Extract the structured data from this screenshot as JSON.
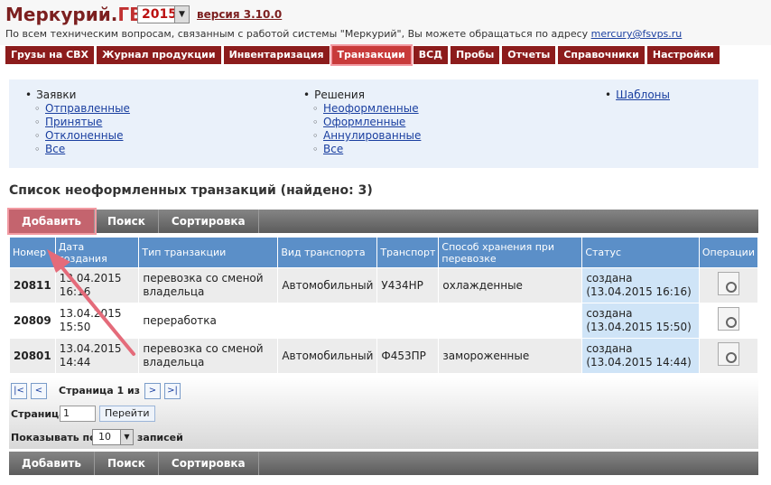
{
  "header": {
    "logo_main": "Меркурий.",
    "logo_accent": "ГВЭ",
    "year": "2015",
    "version": "версия 3.10.0",
    "support_text": "По всем техническим вопросам, связанным с работой системы \"Меркурий\", Вы можете обращаться по адресу ",
    "support_email": "mercury@fsvps.ru"
  },
  "nav": [
    "Грузы на СВХ",
    "Журнал продукции",
    "Инвентаризация",
    "Транзакции",
    "ВСД",
    "Пробы",
    "Отчеты",
    "Справочники",
    "Настройки"
  ],
  "nav_active": "Транзакции",
  "submenu": {
    "requests": {
      "title": "Заявки",
      "items": [
        "Отправленные",
        "Принятые",
        "Отклоненные",
        "Все"
      ]
    },
    "decisions": {
      "title": "Решения",
      "items": [
        "Неоформленные",
        "Оформленные",
        "Аннулированные",
        "Все"
      ]
    },
    "templates": "Шаблоны"
  },
  "list_title": "Список неоформленных транзакций (найдено: 3)",
  "toolbar": {
    "add": "Добавить",
    "search": "Поиск",
    "sort": "Сортировка"
  },
  "table": {
    "columns": [
      "Номер",
      "Дата создания",
      "Тип транзакции",
      "Вид транспорта",
      "Транспорт",
      "Способ хранения при перевозке",
      "Статус",
      "Операции"
    ],
    "rows": [
      {
        "num": "20811",
        "date": "13.04.2015 16:16",
        "type": "перевозка со сменой владельца",
        "transport_kind": "Автомобильный",
        "transport": "У434НР",
        "storage": "охлажденные",
        "status": "создана (13.04.2015 16:16)"
      },
      {
        "num": "20809",
        "date": "13.04.2015 15:50",
        "type": "переработка",
        "transport_kind": "",
        "transport": "",
        "storage": "",
        "status": "создана (13.04.2015 15:50)"
      },
      {
        "num": "20801",
        "date": "13.04.2015 14:44",
        "type": "перевозка со сменой владельца",
        "transport_kind": "Автомобильный",
        "transport": "Ф453ПР",
        "storage": "замороженные",
        "status": "создана (13.04.2015 14:44)"
      }
    ]
  },
  "pager": {
    "first": "|<",
    "prev": "<",
    "next": ">",
    "last": ">|",
    "info": "Страница 1 из 1",
    "page_label": "Страница",
    "page_value": "1",
    "go_label": "Перейти",
    "show_label": "Показывать по:",
    "show_value": "10",
    "records_label": "записей"
  },
  "colors": {
    "brand": "#8c1c1c",
    "nav_active": "#c83a3a",
    "table_header": "#5b8fc8",
    "annotation": "#e46b7a"
  },
  "icons": {
    "operations": "view-magnifier-icon",
    "year_dropdown": "chevron-down-icon"
  }
}
